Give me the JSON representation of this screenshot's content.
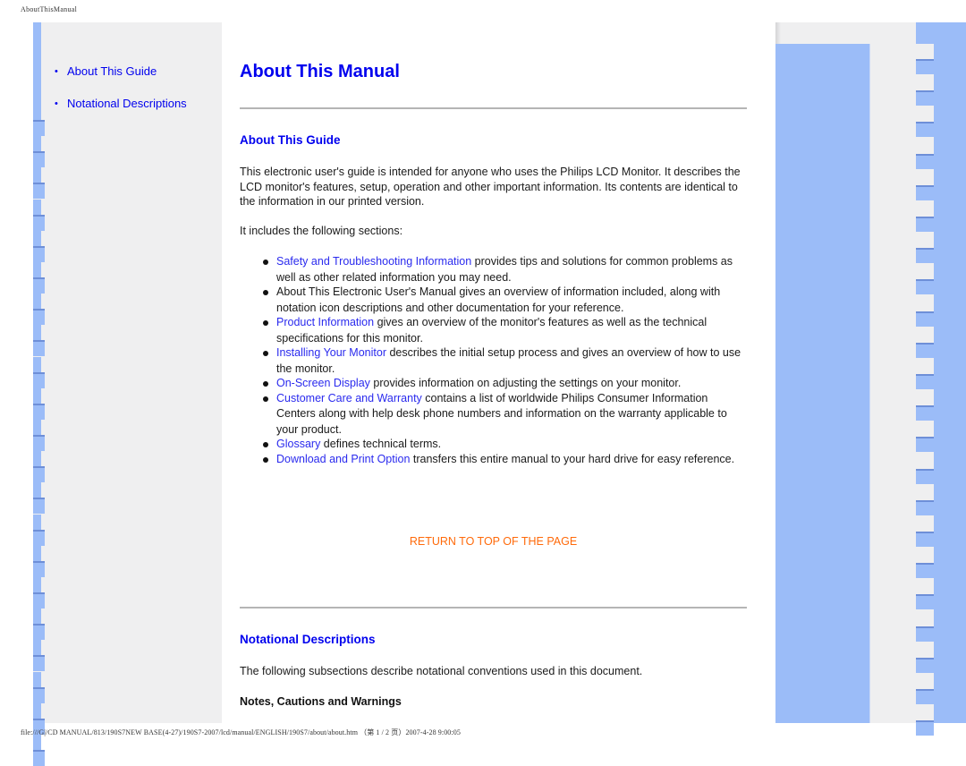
{
  "page_header": "AboutThisManual",
  "page_footer": "file:///G|/CD MANUAL/813/190S7NEW BASE(4-27)/190S7-2007/lcd/manual/ENGLISH/190S7/about/about.htm （第 1 / 2 页）2007-4-28 9:00:05",
  "sidebar": {
    "items": [
      {
        "label": "About This Guide",
        "icon": "bullet-icon"
      },
      {
        "label": "Notational Descriptions",
        "icon": "bullet-icon"
      }
    ]
  },
  "main": {
    "title": "About This Manual",
    "sections": [
      {
        "heading": "About This Guide",
        "intro": "This electronic user's guide is intended for anyone who uses the Philips LCD Monitor. It describes the LCD monitor's features, setup, operation and other important information. Its contents are identical to the information in our printed version.",
        "lead": "It includes the following sections:",
        "items": [
          {
            "link": "Safety and Troubleshooting Information",
            "text": " provides tips and solutions for common problems as well as other related information you may need."
          },
          {
            "link": "",
            "text": "About This Electronic User's Manual gives an overview of information included, along with notation icon descriptions and other documentation for your reference."
          },
          {
            "link": "Product Information",
            "text": " gives an overview of the monitor's features as well as the technical specifications for this monitor."
          },
          {
            "link": "Installing Your Monitor",
            "text": " describes the initial setup process and gives an overview of how to use the monitor."
          },
          {
            "link": "On-Screen Display",
            "text": " provides information on adjusting the settings on your monitor."
          },
          {
            "link": "Customer Care and Warranty",
            "text": " contains a list of worldwide Philips Consumer Information Centers along with help desk phone numbers and information on the warranty applicable to your product."
          },
          {
            "link": "Glossary",
            "text": " defines technical terms."
          },
          {
            "link": "Download and Print Option",
            "text": " transfers this entire manual to your hard drive for easy reference."
          }
        ],
        "return_link": "RETURN TO TOP OF THE PAGE"
      },
      {
        "heading": "Notational Descriptions",
        "intro": "The following subsections describe notational conventions used in this document.",
        "subheading": "Notes, Cautions and Warnings"
      }
    ]
  },
  "colors": {
    "link": "#0000ee",
    "return_link": "#ff6a0a",
    "decor_blue": "#9bbcf8",
    "panel_gray": "#efeff0"
  }
}
